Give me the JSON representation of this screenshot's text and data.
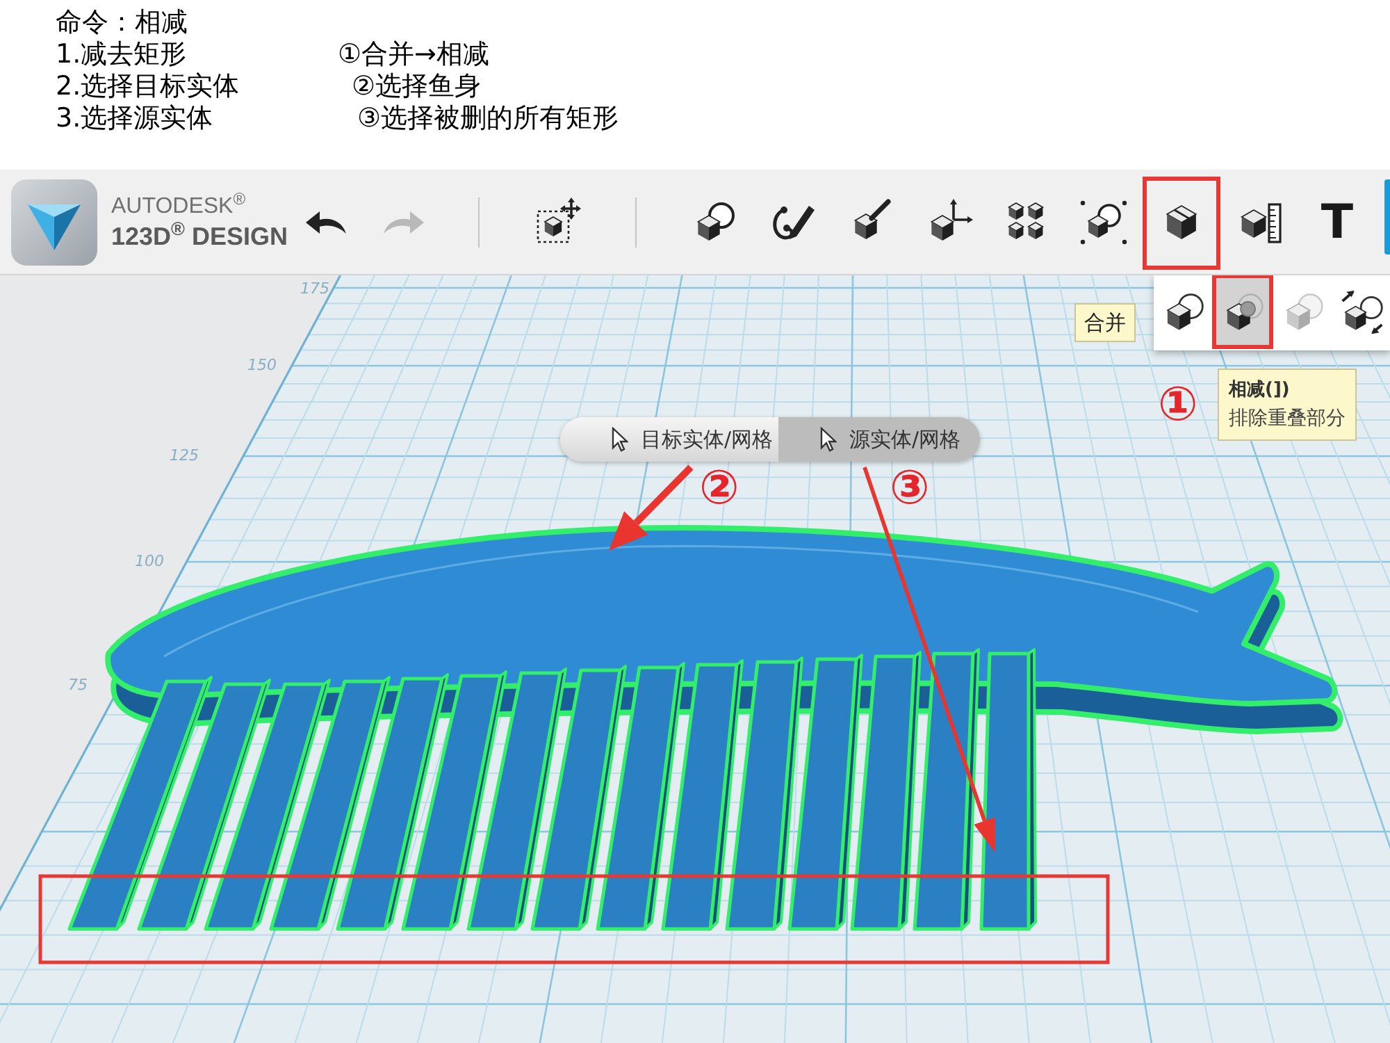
{
  "instructions": {
    "title": "命令：相减",
    "steps": [
      {
        "text": "1.减去矩形",
        "note": "①合并→相减"
      },
      {
        "text": "2.选择目标实体",
        "note": "②选择鱼身"
      },
      {
        "text": "3.选择源实体",
        "note": "③选择被删的所有矩形"
      }
    ]
  },
  "toolbar": {
    "logo": {
      "brand": "AUTODESK$^{®}$",
      "product": "123D$^{®}$ DESIGN"
    },
    "groups": [
      [
        {
          "kind": "undo",
          "disabled": false,
          "marked": false
        },
        {
          "kind": "redo",
          "disabled": true,
          "marked": false
        }
      ],
      [
        {
          "kind": "transform",
          "disabled": false,
          "marked": false
        }
      ],
      [
        {
          "kind": "primitives",
          "disabled": false,
          "marked": false
        },
        {
          "kind": "sketch",
          "disabled": false,
          "marked": false
        },
        {
          "kind": "construct",
          "disabled": false,
          "marked": false
        },
        {
          "kind": "modify",
          "disabled": false,
          "marked": false
        },
        {
          "kind": "pattern",
          "disabled": false,
          "marked": false
        },
        {
          "kind": "grouping",
          "disabled": false,
          "marked": false
        },
        {
          "kind": "combine",
          "disabled": false,
          "marked": true
        },
        {
          "kind": "measure",
          "disabled": false,
          "marked": false
        },
        {
          "kind": "text",
          "label": "T",
          "disabled": false,
          "marked": false
        },
        {
          "kind": "material",
          "disabled": false,
          "marked": false
        }
      ]
    ]
  },
  "combine_menu": [
    {
      "kind": "merge",
      "selected": false,
      "marked": false
    },
    {
      "kind": "subtract",
      "selected": true,
      "marked": true
    },
    {
      "kind": "intersect",
      "selected": false,
      "marked": false
    },
    {
      "kind": "separate",
      "selected": false,
      "marked": false
    }
  ],
  "tooltips": [
    {
      "title": "合并"
    },
    {
      "title": "相减(])",
      "description": "排除重叠部分"
    }
  ],
  "selection_bar": [
    {
      "label": "目标实体/网格",
      "selected": false
    },
    {
      "label": "源实体/网格",
      "selected": true
    }
  ],
  "callouts": [
    "①",
    "②",
    "③"
  ],
  "grid_labels": [
    "175",
    "150",
    "125",
    "100",
    "75"
  ]
}
